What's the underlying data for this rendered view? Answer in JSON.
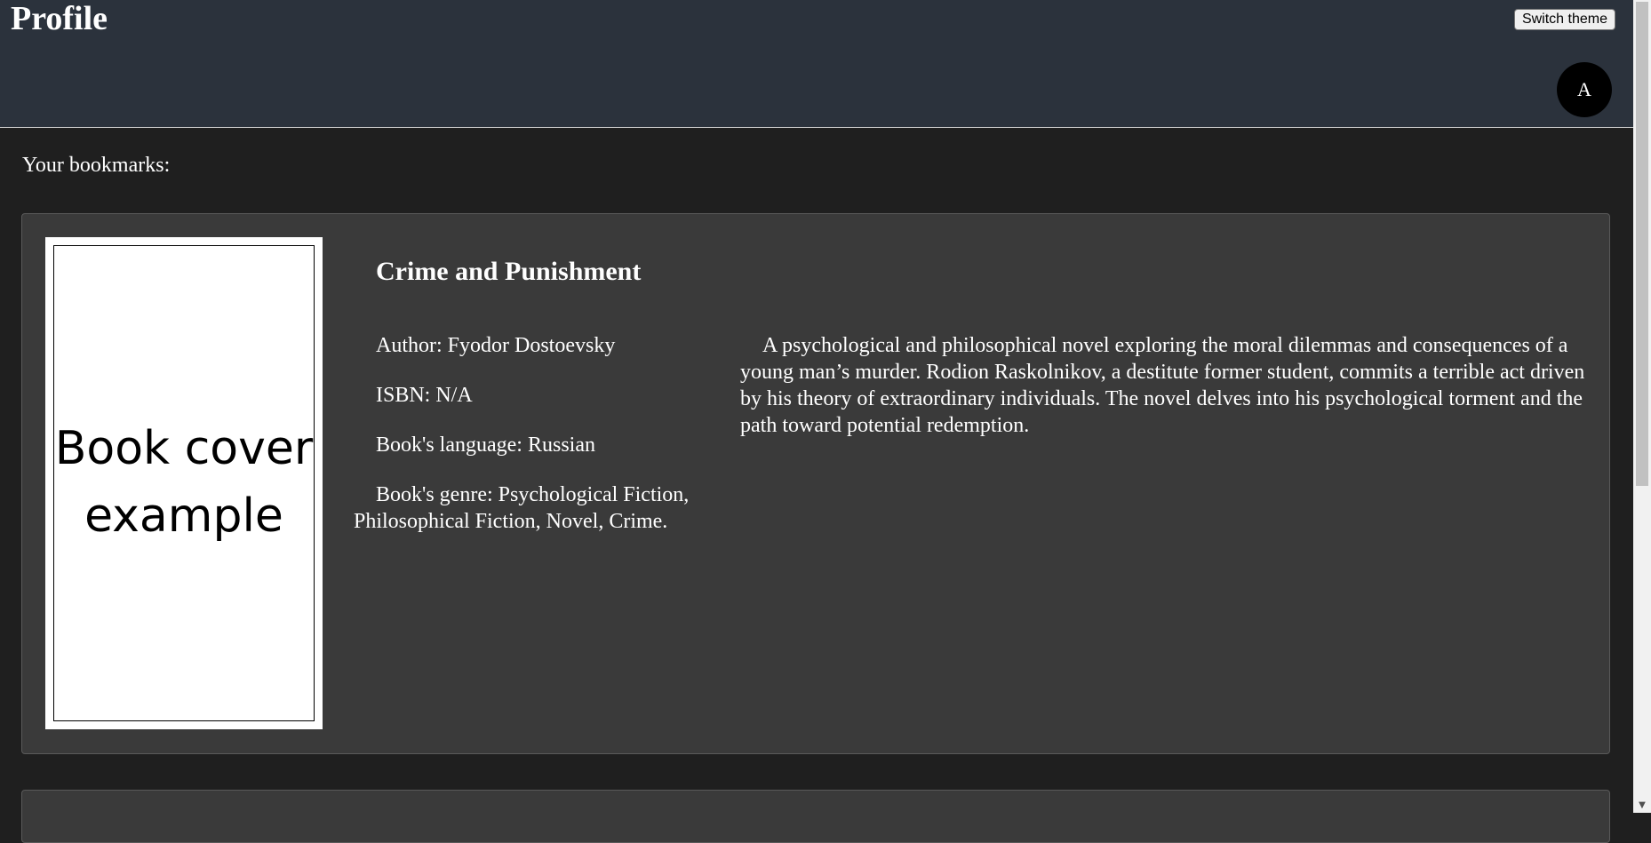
{
  "header": {
    "title": "Profile",
    "switch_theme_label": "Switch theme",
    "avatar_initial": "A"
  },
  "bookmarks": {
    "label": "Your bookmarks:",
    "items": [
      {
        "cover_text": "Book cover example",
        "title": "Crime and Punishment",
        "author": "Author: Fyodor Dostoevsky",
        "isbn": "ISBN: N/A",
        "language": "Book's language: Russian",
        "genre": "Book's genre: Psychological Fiction, Philosophical Fiction, Novel, Crime.",
        "description": "A psychological and philosophical novel exploring the moral dilemmas and consequences of a young man’s murder. Rodion Raskolnikov, a destitute former student, commits a terrible act driven by his theory of extraordinary individuals. The novel delves into his psychological torment and the path toward potential redemption."
      }
    ]
  },
  "icons": {
    "scroll_down": "scroll-down-arrow-icon"
  },
  "colors": {
    "header_bg": "#2b323c",
    "page_bg": "#1f1f1f",
    "card_bg": "#3a3a3a"
  }
}
